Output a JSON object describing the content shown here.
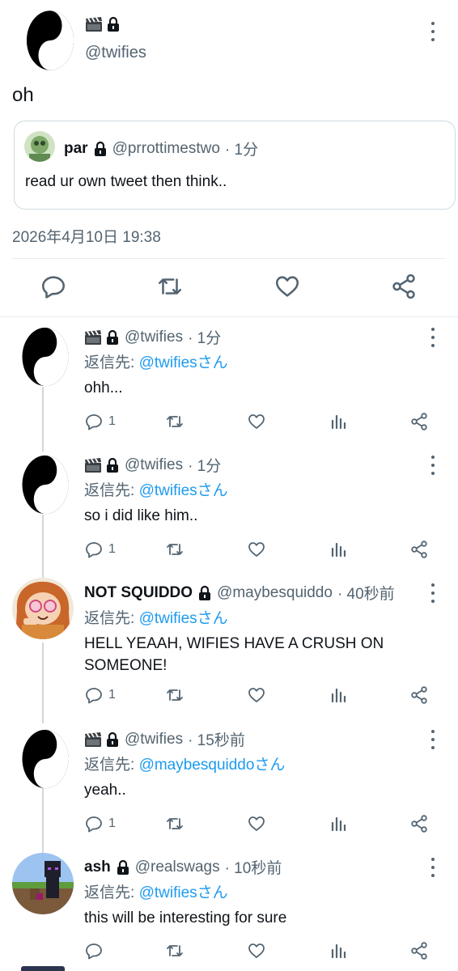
{
  "main_tweet": {
    "handle": "@twifies",
    "text": "oh",
    "quote": {
      "name": "par",
      "handle": "@prrottimestwo",
      "time": "· 1分",
      "text": "read ur own tweet then think.."
    },
    "timestamp": "2026年4月10日 19:38"
  },
  "replies": [
    {
      "name": "",
      "handle": "@twifies",
      "time": "· 1分",
      "to_prefix": "返信先: ",
      "to_link": "@twifiesさん",
      "text": "ohh...",
      "replies": "1"
    },
    {
      "name": "",
      "handle": "@twifies",
      "time": "· 1分",
      "to_prefix": "返信先: ",
      "to_link": "@twifiesさん",
      "text": "so i did like him..",
      "replies": "1"
    },
    {
      "name": "NOT SQUIDDO",
      "handle": "@maybesquiddo",
      "time": "· 40秒前",
      "to_prefix": "返信先: ",
      "to_link": "@twifiesさん",
      "text": "HELL YEAAH, WIFIES HAVE A CRUSH ON SOMEONE!",
      "replies": "1"
    },
    {
      "name": "",
      "handle": "@twifies",
      "time": "· 15秒前",
      "to_prefix": "返信先: ",
      "to_link": "@maybesquiddoさん",
      "text": "yeah..",
      "replies": "1"
    },
    {
      "name": "ash",
      "handle": "@realswags",
      "time": "· 10秒前",
      "to_prefix": "返信先: ",
      "to_link": "@twifiesさん",
      "text": "this will be interesting for sure",
      "replies": ""
    }
  ],
  "icons": {
    "yin_yang": "yin-yang-icon",
    "clapper": "clapperboard-icon",
    "lock": "lock-icon"
  }
}
